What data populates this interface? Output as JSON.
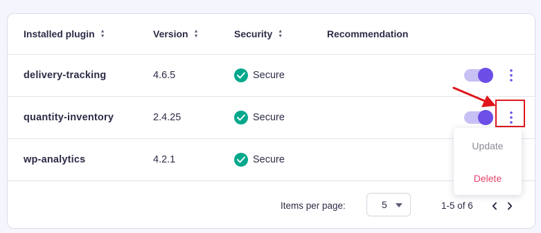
{
  "table": {
    "headers": {
      "plugin": "Installed plugin",
      "version": "Version",
      "security": "Security",
      "recommendation": "Recommendation"
    },
    "rows": [
      {
        "name": "delivery-tracking",
        "version": "4.6.5",
        "security": "Secure",
        "enabled": true
      },
      {
        "name": "quantity-inventory",
        "version": "2.4.25",
        "security": "Secure",
        "enabled": true
      },
      {
        "name": "wp-analytics",
        "version": "4.2.1",
        "security": "Secure",
        "enabled": true
      }
    ]
  },
  "menu": {
    "update_label": "Update",
    "delete_label": "Delete"
  },
  "pagination": {
    "items_per_page_label": "Items per page:",
    "items_per_page_value": "5",
    "range_text": "1-5 of 6"
  },
  "colors": {
    "accent": "#6d4ee6",
    "toggle_track": "#c7c0f4",
    "secure_green": "#00a88c",
    "delete_red": "#e8436a",
    "annotation_red": "#e0151b"
  },
  "icons": {
    "sort": "sort-icon",
    "secure": "check-circle-icon",
    "more": "kebab-menu-icon",
    "dropdown": "chevron-down-icon",
    "prev": "chevron-left-icon",
    "next": "chevron-right-icon",
    "annotation": "arrow-icon"
  }
}
